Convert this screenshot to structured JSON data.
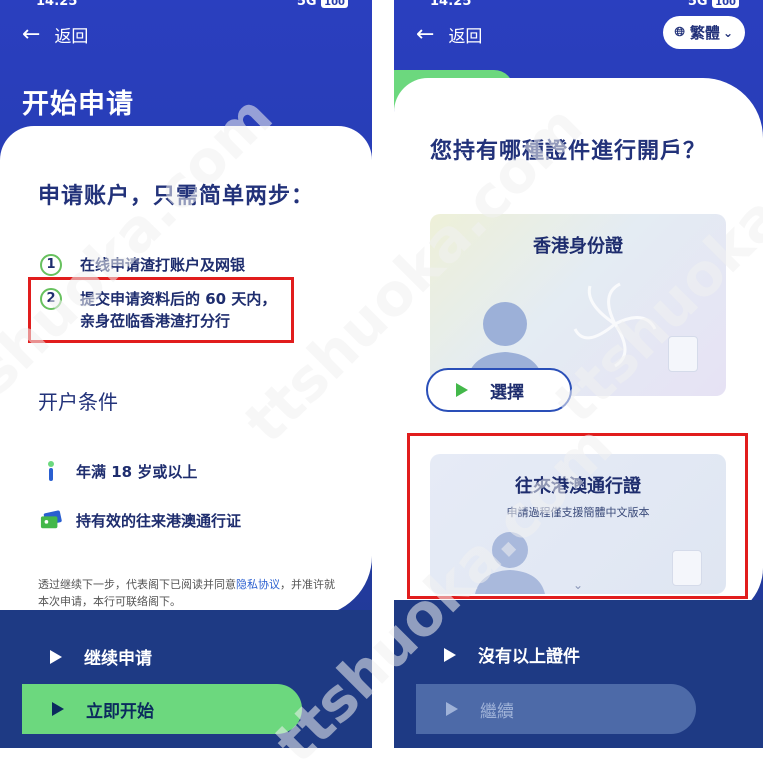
{
  "left": {
    "status_time": "14:25",
    "status_signal": "5G",
    "status_battery": "100",
    "back_label": "返回",
    "page_title": "开始申请",
    "heading": "申请账户，只需简单两步：",
    "steps": [
      {
        "num": "1",
        "text": "在线申请渣打账户及网银"
      },
      {
        "num": "2",
        "line1": "提交申请资料后的 60 天内，",
        "line2": "亲身莅临香港渣打分行"
      }
    ],
    "conditions_title": "开户条件",
    "conditions": [
      {
        "icon": "person-age-icon",
        "text": "年满 18 岁或以上"
      },
      {
        "icon": "id-card-icon",
        "text": "持有效的往来港澳通行证"
      }
    ],
    "fine_print_before": "透过继续下一步，代表阁下已阅读并同意",
    "fine_print_link": "隐私协议",
    "fine_print_after": "，并准许就本次申请，本行可联络阁下。",
    "continue_label": "继续申请",
    "start_label": "立即开始"
  },
  "right": {
    "status_time": "14:25",
    "status_signal": "5G",
    "status_battery": "100",
    "back_label": "返回",
    "language_label": "繁體",
    "question": "您持有哪種證件進行開戶？",
    "card1_title": "香港身份證",
    "card1_button": "選擇",
    "card2_title": "往來港澳通行證",
    "card2_subtitle": "申請過程僅支援簡體中文版本",
    "none_label": "沒有以上證件",
    "continue_label": "繼續"
  },
  "watermarks": [
    "ttshuoka.com",
    "ttshuoka.com",
    "ttshuoka.com",
    "ttshuoka.com"
  ],
  "colors": {
    "brand_blue": "#243aa8",
    "accent_green": "#6cd87e",
    "highlight_red": "#e11d1d"
  }
}
